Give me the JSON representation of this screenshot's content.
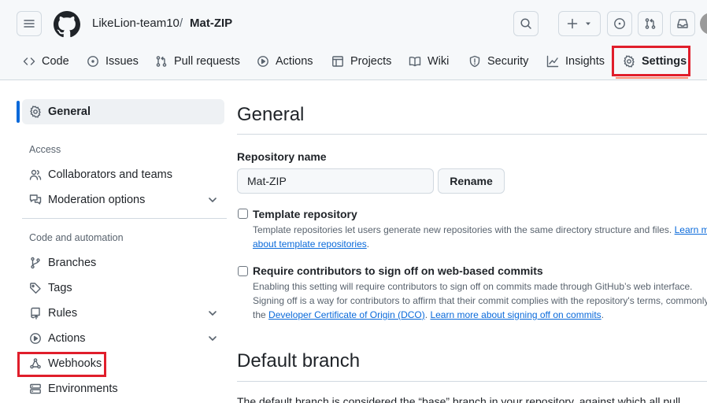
{
  "header": {
    "owner": "LikeLion-team10",
    "separator": "/",
    "repo": "Mat-ZIP"
  },
  "tabs": [
    {
      "label": "Code",
      "icon": "code-icon"
    },
    {
      "label": "Issues",
      "icon": "issue-opened-icon"
    },
    {
      "label": "Pull requests",
      "icon": "git-pull-request-icon"
    },
    {
      "label": "Actions",
      "icon": "play-icon"
    },
    {
      "label": "Projects",
      "icon": "table-icon"
    },
    {
      "label": "Wiki",
      "icon": "book-icon"
    },
    {
      "label": "Security",
      "icon": "shield-icon"
    },
    {
      "label": "Insights",
      "icon": "graph-icon"
    },
    {
      "label": "Settings",
      "icon": "gear-icon",
      "active": true
    }
  ],
  "sidebar": {
    "general": "General",
    "access_heading": "Access",
    "collaborators": "Collaborators and teams",
    "moderation": "Moderation options",
    "code_heading": "Code and automation",
    "branches": "Branches",
    "tags": "Tags",
    "rules": "Rules",
    "actions": "Actions",
    "webhooks": "Webhooks",
    "environments": "Environments"
  },
  "main": {
    "title": "General",
    "repo_name_label": "Repository name",
    "repo_name_value": "Mat-ZIP",
    "rename_button": "Rename",
    "template": {
      "title": "Template repository",
      "desc_line1": "Template repositories let users generate new repositories with the same directory structure and files.",
      "desc_link1": "Learn more",
      "desc_link2": "about template repositories",
      "desc_end": "."
    },
    "signoff": {
      "title": "Require contributors to sign off on web-based commits",
      "desc_line1": "Enabling this setting will require contributors to sign off on commits made through GitHub’s web interface.",
      "desc_line2": "Signing off is a way for contributors to affirm that their commit complies with the repository's terms, commonly",
      "desc_line3_pre": "the",
      "desc_link1": "Developer Certificate of Origin (DCO)",
      "desc_mid": ".",
      "desc_link2": "Learn more about signing off on commits",
      "desc_end": "."
    },
    "default_branch_title": "Default branch",
    "default_branch_desc": "The default branch is considered the “base” branch in your repository, against which all pull"
  },
  "colors": {
    "accent_blue": "#0969da",
    "highlight_red": "#e01e2b",
    "tab_underline": "#fd8c73"
  }
}
